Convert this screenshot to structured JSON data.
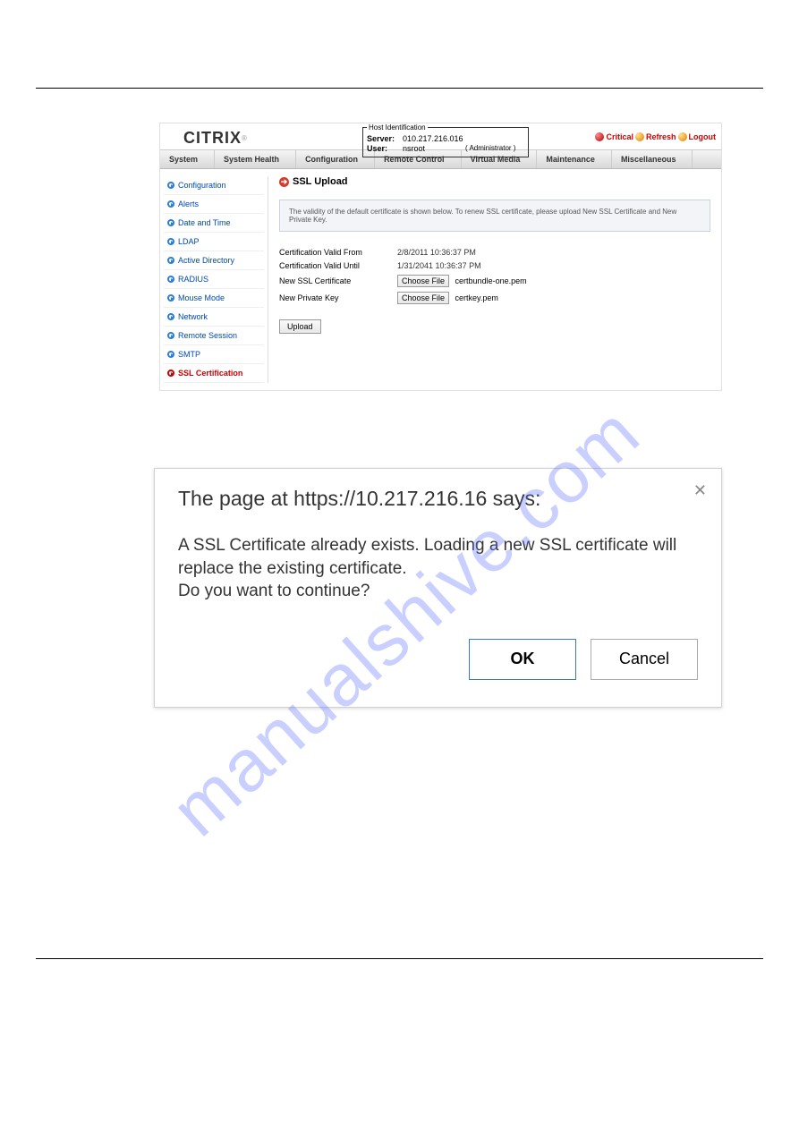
{
  "logo": "CITRIX",
  "hostid": {
    "legend": "Host Identification",
    "server_label": "Server:",
    "server_value": "010.217.216.016",
    "user_label": "User:",
    "user_value": "nsroot",
    "user_role": "( Administrator )"
  },
  "status": {
    "critical": "Critical",
    "refresh": "Refresh",
    "logout": "Logout"
  },
  "menubar": [
    "System",
    "System Health",
    "Configuration",
    "Remote Control",
    "Virtual Media",
    "Maintenance",
    "Miscellaneous"
  ],
  "sidebar": {
    "items": [
      {
        "label": "Configuration"
      },
      {
        "label": "Alerts"
      },
      {
        "label": "Date and Time"
      },
      {
        "label": "LDAP"
      },
      {
        "label": "Active Directory"
      },
      {
        "label": "RADIUS"
      },
      {
        "label": "Mouse Mode"
      },
      {
        "label": "Network"
      },
      {
        "label": "Remote Session"
      },
      {
        "label": "SMTP"
      },
      {
        "label": "SSL Certification"
      }
    ]
  },
  "main": {
    "title": "SSL Upload",
    "info": "The validity of the default certificate is shown below. To renew SSL certificate, please upload New SSL Certificate and New Private Key.",
    "rows": {
      "valid_from_label": "Certification Valid From",
      "valid_from_value": "2/8/2011 10:36:37 PM",
      "valid_until_label": "Certification Valid Until",
      "valid_until_value": "1/31/2041 10:36:37 PM",
      "new_cert_label": "New SSL Certificate",
      "choose_file": "Choose File",
      "cert_file": "certbundle-one.pem",
      "new_key_label": "New Private Key",
      "key_file": "certkey.pem"
    },
    "upload": "Upload"
  },
  "dialog": {
    "title": "The page at https://10.217.216.16 says:",
    "message": "A SSL Certificate already exists. Loading a new SSL certificate will replace the existing certificate.\nDo you want to continue?",
    "ok": "OK",
    "cancel": "Cancel"
  },
  "watermark": "manualshive.com"
}
